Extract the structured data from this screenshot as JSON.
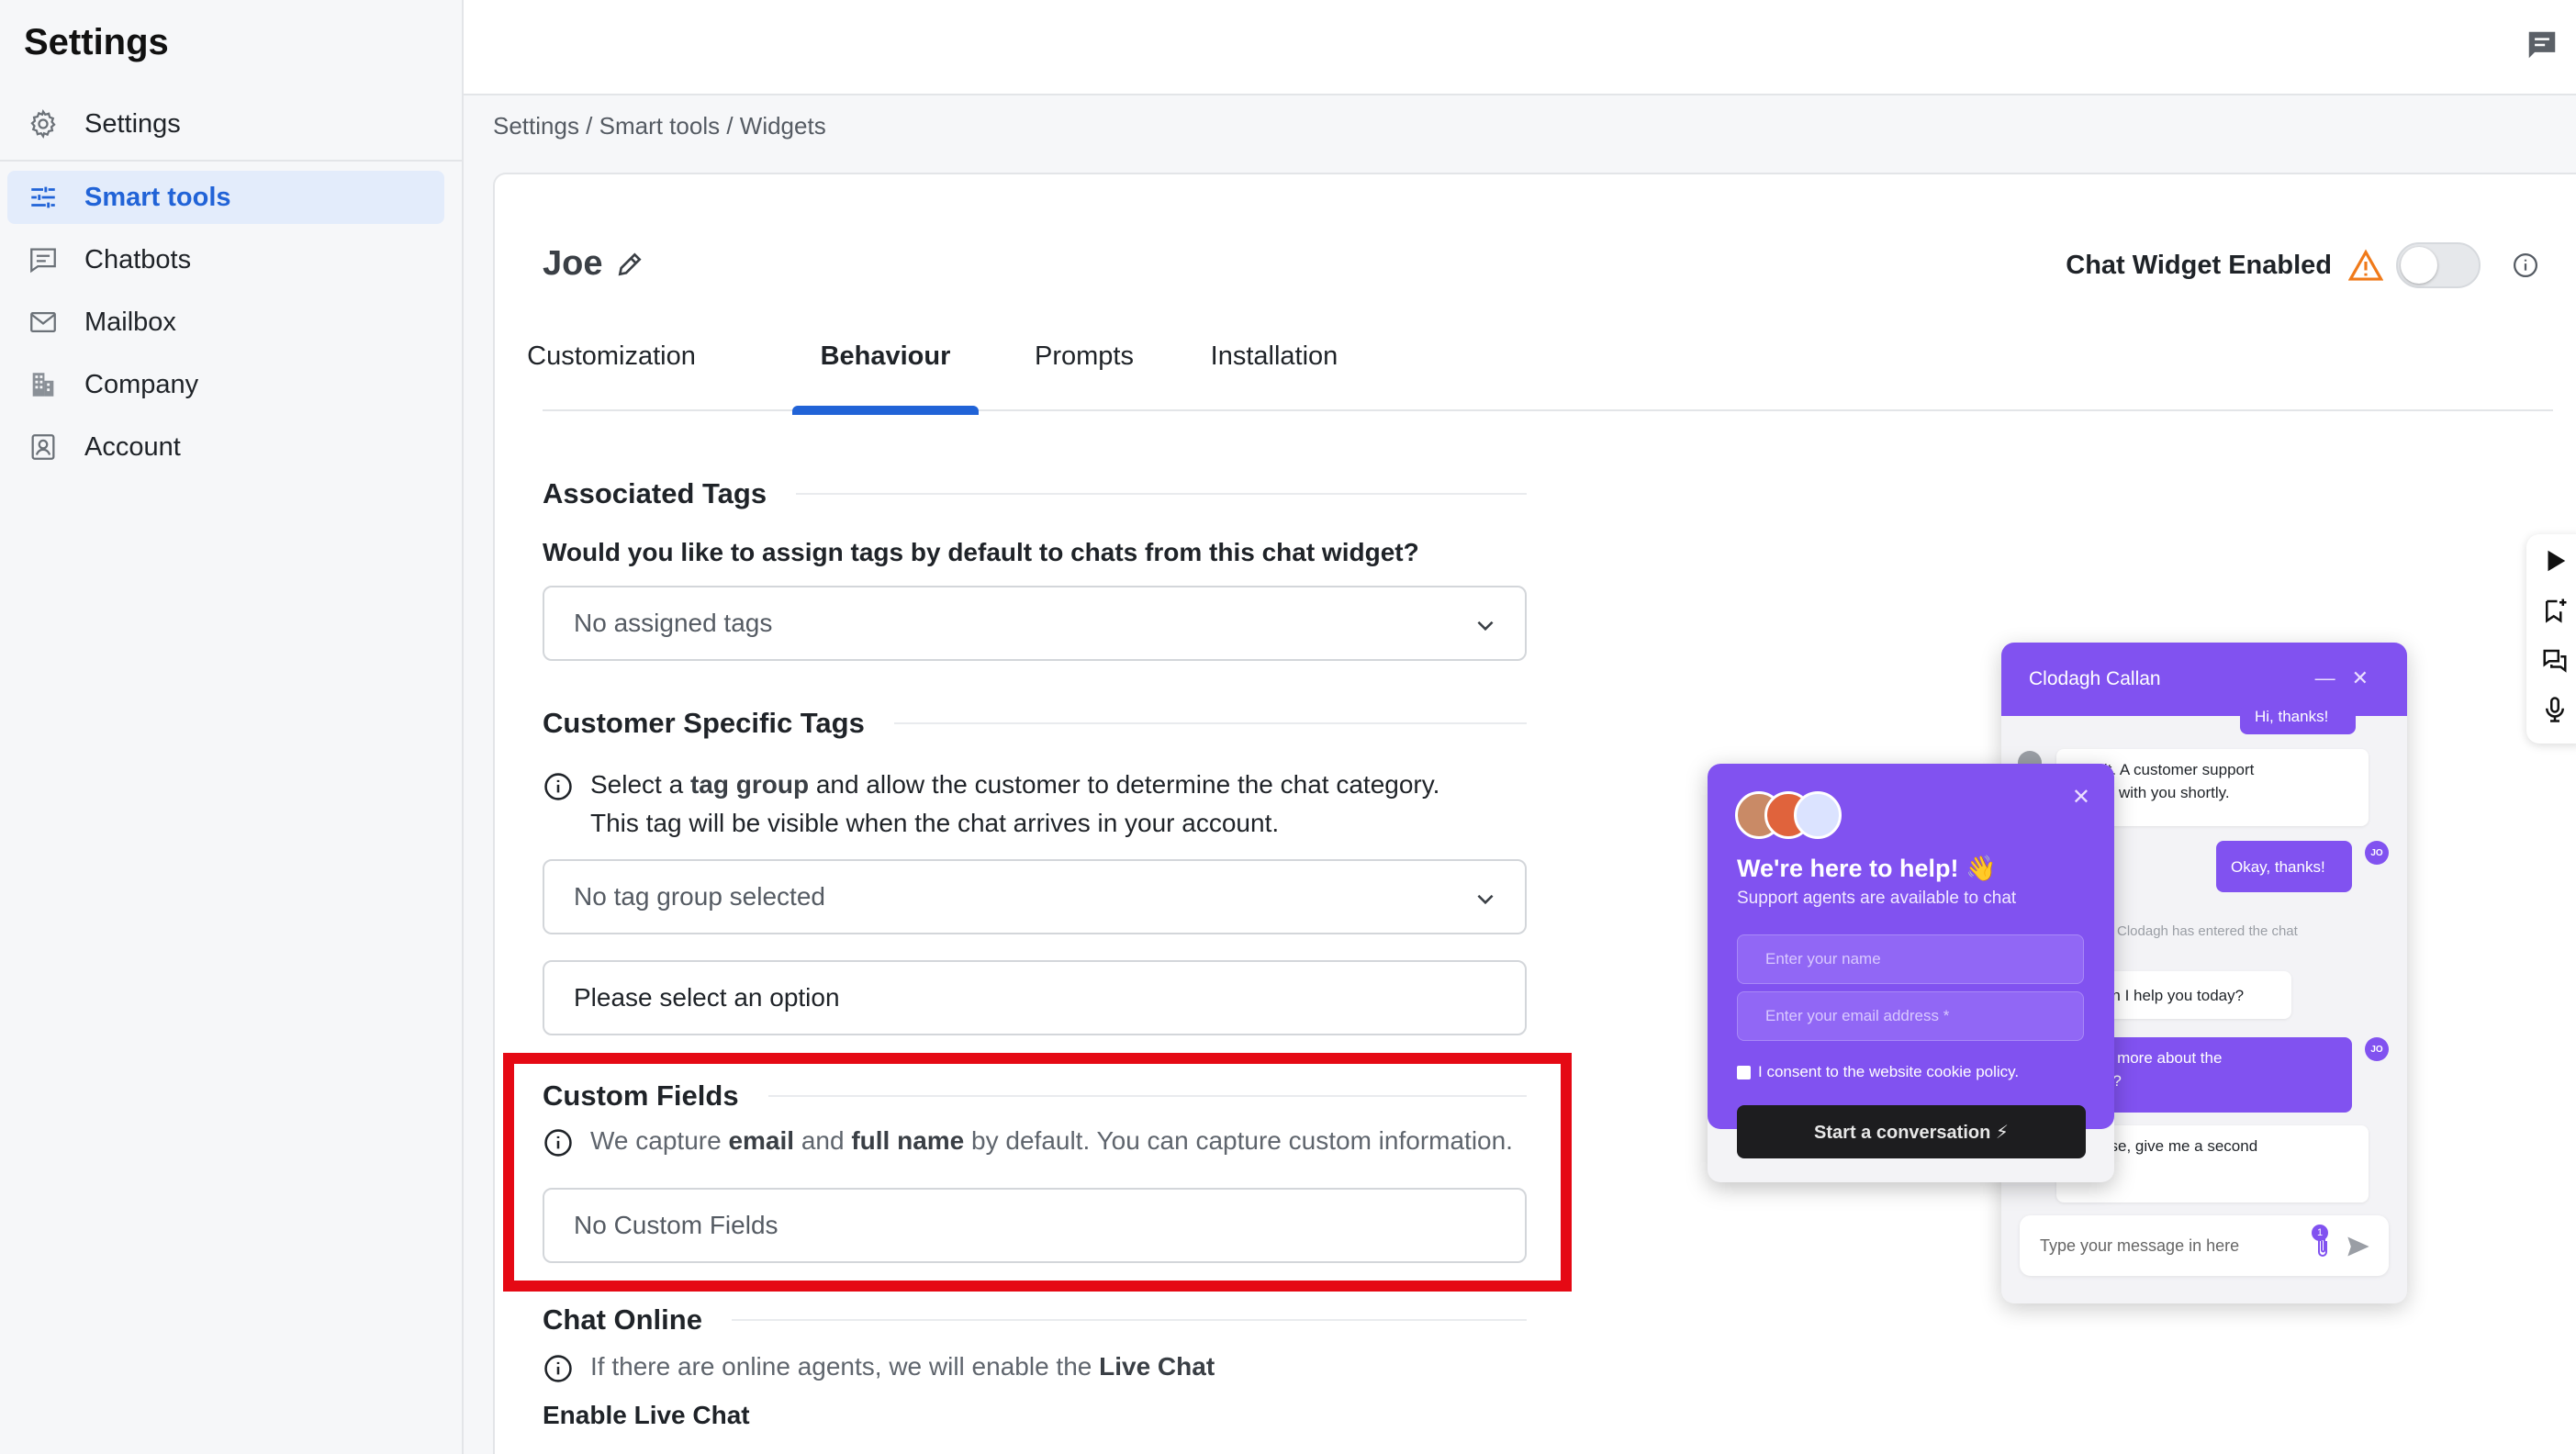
{
  "sidebar": {
    "title": "Settings",
    "items": [
      {
        "label": "Settings",
        "icon": "gear-icon"
      },
      {
        "label": "Smart tools",
        "icon": "sliders-icon",
        "active": true
      },
      {
        "label": "Chatbots",
        "icon": "chat-lines-icon"
      },
      {
        "label": "Mailbox",
        "icon": "envelope-icon"
      },
      {
        "label": "Company",
        "icon": "building-icon"
      },
      {
        "label": "Account",
        "icon": "user-card-icon"
      }
    ]
  },
  "breadcrumb": "Settings / Smart tools / Widgets",
  "widget": {
    "name": "Joe",
    "enabled_label": "Chat Widget Enabled",
    "enabled": false
  },
  "tabs": [
    {
      "label": "Customization"
    },
    {
      "label": "Behaviour",
      "active": true
    },
    {
      "label": "Prompts"
    },
    {
      "label": "Installation"
    }
  ],
  "associated_tags": {
    "title": "Associated Tags",
    "question": "Would you like to assign tags by default to chats from this chat widget?",
    "select_value": "No assigned tags"
  },
  "customer_tags": {
    "title": "Customer Specific Tags",
    "info_pre": "Select a ",
    "info_bold": "tag group",
    "info_post": " and allow the customer to determine the chat category.",
    "info_line2": "This tag will be visible when the chat arrives in your account.",
    "select_value": "No tag group selected",
    "option_value": "Please select an option"
  },
  "custom_fields": {
    "title": "Custom Fields",
    "info_pre": "We capture ",
    "info_bold1": "email",
    "info_mid": " and ",
    "info_bold2": "full name",
    "info_post": " by default. You can capture custom information.",
    "value": "No Custom Fields"
  },
  "chat_online": {
    "title": "Chat Online",
    "info_pre": "If there are online agents, we will enable the ",
    "info_bold": "Live Chat",
    "enable_label": "Enable Live Chat"
  },
  "chat_preview": {
    "agent_name": "Clodagh Callan",
    "messages": [
      {
        "from": "user",
        "text": "Hi, thanks!"
      },
      {
        "from": "agent",
        "text": "e wait. A customer support\nwill be with you shortly."
      },
      {
        "from": "user",
        "text": "Okay, thanks!"
      },
      {
        "from": "system",
        "text": "Clodagh has entered the chat"
      },
      {
        "from": "agent",
        "text": "ow can I help you today?"
      },
      {
        "from": "user",
        "text": "ell me more about the\nn sale?"
      },
      {
        "from": "agent",
        "text": "f course, give me a second\nse."
      }
    ],
    "user_initials": "JO",
    "input_placeholder": "Type your message in here",
    "attachment_count": "1"
  },
  "prechat": {
    "heading": "We're here to help! 👋",
    "subheading": "Support agents are available to chat",
    "name_placeholder": "Enter your name",
    "email_placeholder": "Enter your email address *",
    "consent": "I consent to the website cookie policy.",
    "start_button": "Start a conversation ⚡"
  },
  "colors": {
    "accent": "#2163d7",
    "widget_purple": "#8152f0",
    "highlight": "#e50914",
    "warning": "#f07a1a"
  }
}
